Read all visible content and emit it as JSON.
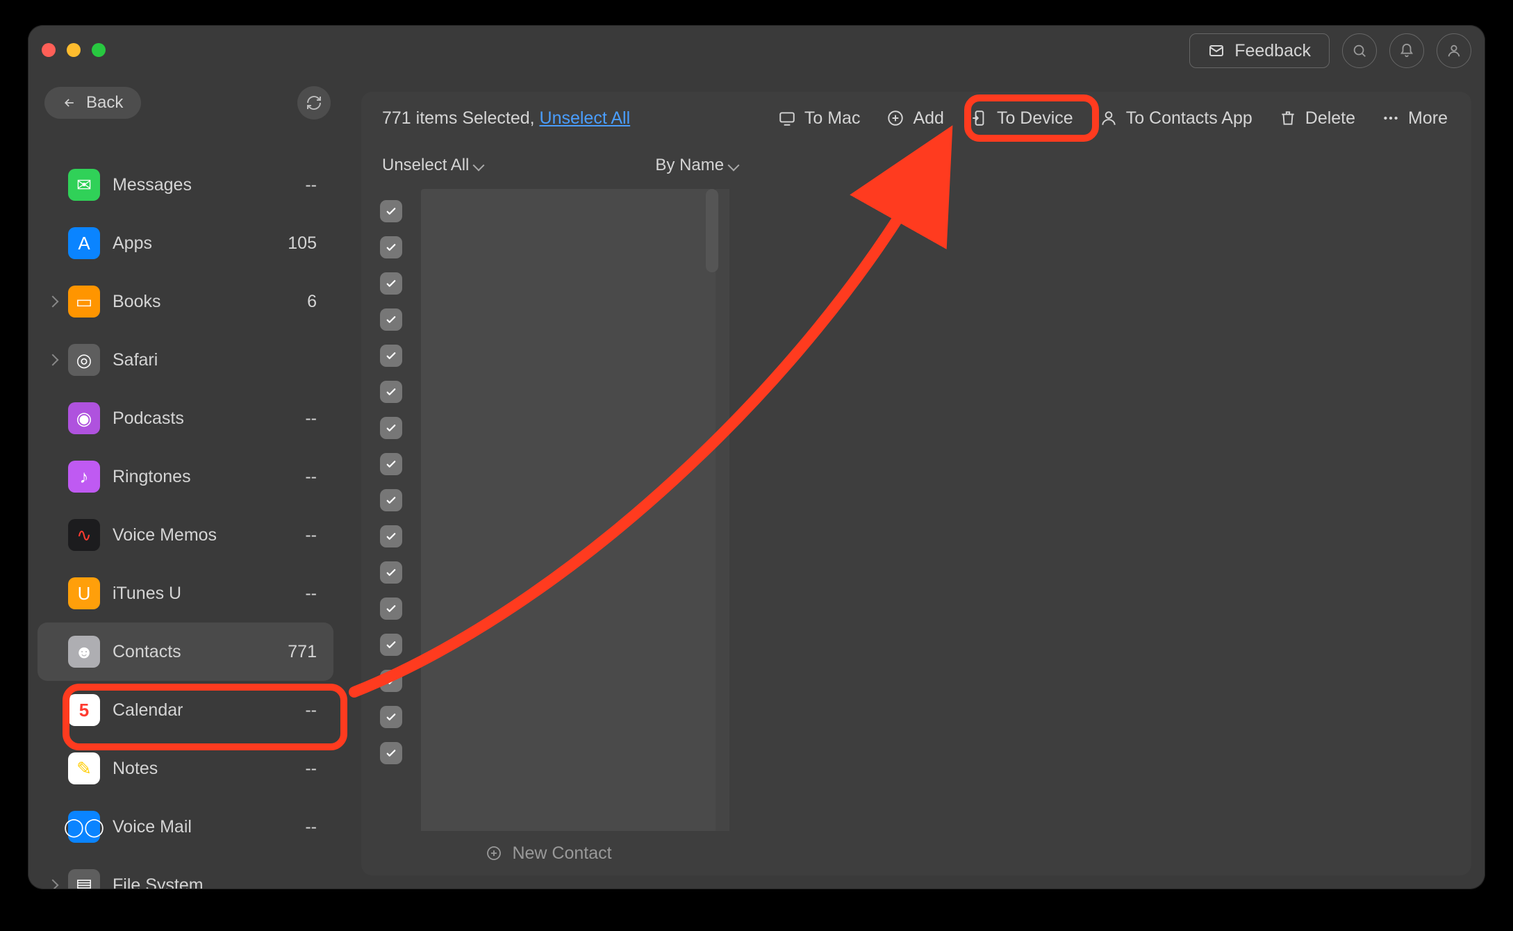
{
  "header": {
    "feedback_label": "Feedback"
  },
  "sidebar": {
    "back_label": "Back",
    "items": [
      {
        "label": "Messages",
        "count": "--",
        "icon": "messages",
        "arrow": false
      },
      {
        "label": "Apps",
        "count": "105",
        "icon": "apps",
        "arrow": false
      },
      {
        "label": "Books",
        "count": "6",
        "icon": "books",
        "arrow": true
      },
      {
        "label": "Safari",
        "count": "",
        "icon": "safari",
        "arrow": true
      },
      {
        "label": "Podcasts",
        "count": "--",
        "icon": "podcasts",
        "arrow": false
      },
      {
        "label": "Ringtones",
        "count": "--",
        "icon": "ringtones",
        "arrow": false
      },
      {
        "label": "Voice Memos",
        "count": "--",
        "icon": "voicememos",
        "arrow": false
      },
      {
        "label": "iTunes U",
        "count": "--",
        "icon": "itunesu",
        "arrow": false
      },
      {
        "label": "Contacts",
        "count": "771",
        "icon": "contacts",
        "arrow": false,
        "selected": true
      },
      {
        "label": "Calendar",
        "count": "--",
        "icon": "calendar",
        "arrow": false
      },
      {
        "label": "Notes",
        "count": "--",
        "icon": "notes",
        "arrow": false
      },
      {
        "label": "Voice Mail",
        "count": "--",
        "icon": "voicemail",
        "arrow": false
      },
      {
        "label": "File System",
        "count": "",
        "icon": "filesystem",
        "arrow": true
      }
    ]
  },
  "main": {
    "status_prefix": "771 items Selected, ",
    "status_link": "Unselect All",
    "tools": {
      "to_mac": "To Mac",
      "add": "Add",
      "to_device": "To Device",
      "to_contacts_app": "To Contacts App",
      "delete": "Delete",
      "more": "More"
    },
    "subbar": {
      "unselect_all": "Unselect All",
      "by_name": "By Name"
    },
    "checkbox_count": 16,
    "new_contact": "New Contact"
  },
  "colors": {
    "highlight": "#ff3b1f",
    "link": "#4a9eff"
  }
}
